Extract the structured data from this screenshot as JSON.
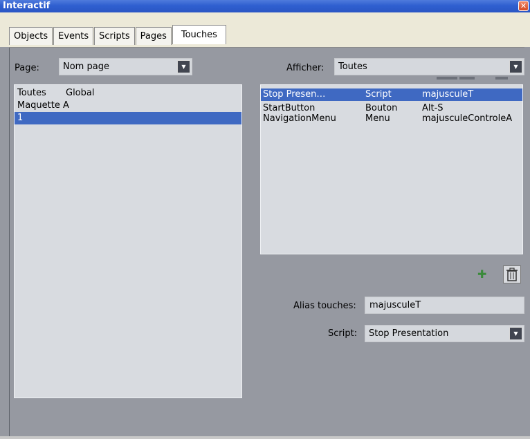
{
  "window": {
    "title": "Interactif",
    "close_label": "✕"
  },
  "tabs": [
    "Objects",
    "Events",
    "Scripts",
    "Pages",
    "Touches"
  ],
  "left": {
    "page_label": "Page:",
    "page_value": "Nom page",
    "list": [
      {
        "col1": "Toutes",
        "col2": "Global"
      },
      {
        "col1": "Maquette A",
        "col2": ""
      },
      {
        "col1": "1",
        "col2": ""
      }
    ],
    "selected_index": 2
  },
  "right": {
    "show_label": "Afficher:",
    "show_value": "Toutes",
    "list": [
      {
        "name": "Stop Presen…",
        "type": "Script",
        "key": "majusculeT"
      },
      {
        "name": "StartButton",
        "type": "Bouton",
        "key": "Alt-S"
      },
      {
        "name": "NavigationMenu",
        "type": "Menu",
        "key": "majusculeControleA"
      }
    ],
    "selected_index": 0,
    "add_icon": "plus-icon",
    "delete_icon": "trash-icon",
    "alias_label": "Alias touches:",
    "alias_value": "majusculeT",
    "script_label": "Script:",
    "script_value": "Stop Presentation"
  },
  "colors": {
    "selection": "#3f69c2",
    "titlebar": "#2f5fd0",
    "panel_bg": "#9699a1"
  }
}
